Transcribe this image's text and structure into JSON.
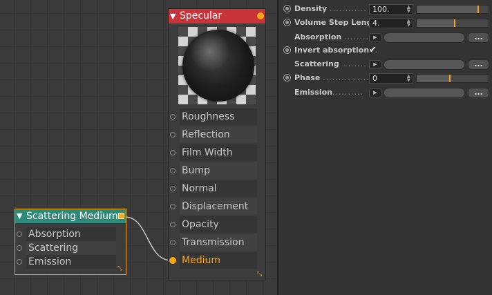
{
  "specular_node": {
    "title": "Specular",
    "header_color": "#c8343a",
    "ports": [
      {
        "label": "Roughness",
        "connected": false
      },
      {
        "label": "Reflection",
        "connected": false
      },
      {
        "label": "Film Width",
        "connected": false
      },
      {
        "label": "Bump",
        "connected": false
      },
      {
        "label": "Normal",
        "connected": false
      },
      {
        "label": "Displacement",
        "connected": false
      },
      {
        "label": "Opacity",
        "connected": false
      },
      {
        "label": "Transmission",
        "connected": false
      },
      {
        "label": "Medium",
        "connected": true
      }
    ]
  },
  "scattering_node": {
    "title": "Scattering Medium",
    "header_color": "#2e8a78",
    "ports": [
      {
        "label": "Absorption"
      },
      {
        "label": "Scattering"
      },
      {
        "label": "Emission"
      }
    ]
  },
  "attributes": {
    "density": {
      "label": "Density",
      "dots": "............",
      "value": "100.",
      "slider_fraction": 0.86
    },
    "volume_step_length": {
      "label": "Volume Step Length",
      "value": "4.",
      "slider_fraction": 0.53
    },
    "absorption": {
      "label": "Absorption",
      "dots": "........",
      "more_label": "..."
    },
    "invert_absorption": {
      "label": "Invert absorption",
      "dots": "..",
      "checked": true,
      "check_glyph": "✔"
    },
    "scattering": {
      "label": "Scattering",
      "dots": "........",
      "more_label": "..."
    },
    "phase": {
      "label": "Phase",
      "dots": "...............",
      "value": "0",
      "slider_fraction": 0.46
    },
    "emission": {
      "label": "Emission",
      "dots": "..........",
      "more_label": "..."
    }
  },
  "accent_color": "#f6a616"
}
